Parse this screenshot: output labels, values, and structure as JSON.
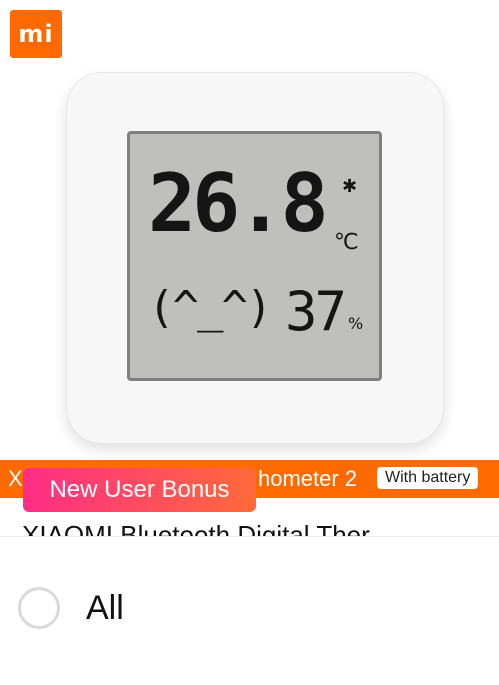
{
  "brand": {
    "logo_text": "mi",
    "accent_color": "#ff6a00"
  },
  "device_display": {
    "temperature": "26.8",
    "temperature_unit": "℃",
    "bluetooth_icon": "bluetooth-icon",
    "face": "(^_^)",
    "humidity": "37",
    "humidity_unit": "%"
  },
  "promo_band": {
    "lead_char": "X",
    "title_fragment": "hometer 2",
    "battery_tag": "With battery"
  },
  "bonus_badge": {
    "label": "New User Bonus",
    "gradient": [
      "#ff2d86",
      "#ff6a3a"
    ]
  },
  "product": {
    "title": "XIAOMI Bluetooth Digital Ther"
  },
  "options": {
    "items": [
      {
        "label": "All",
        "selected": false
      }
    ]
  }
}
